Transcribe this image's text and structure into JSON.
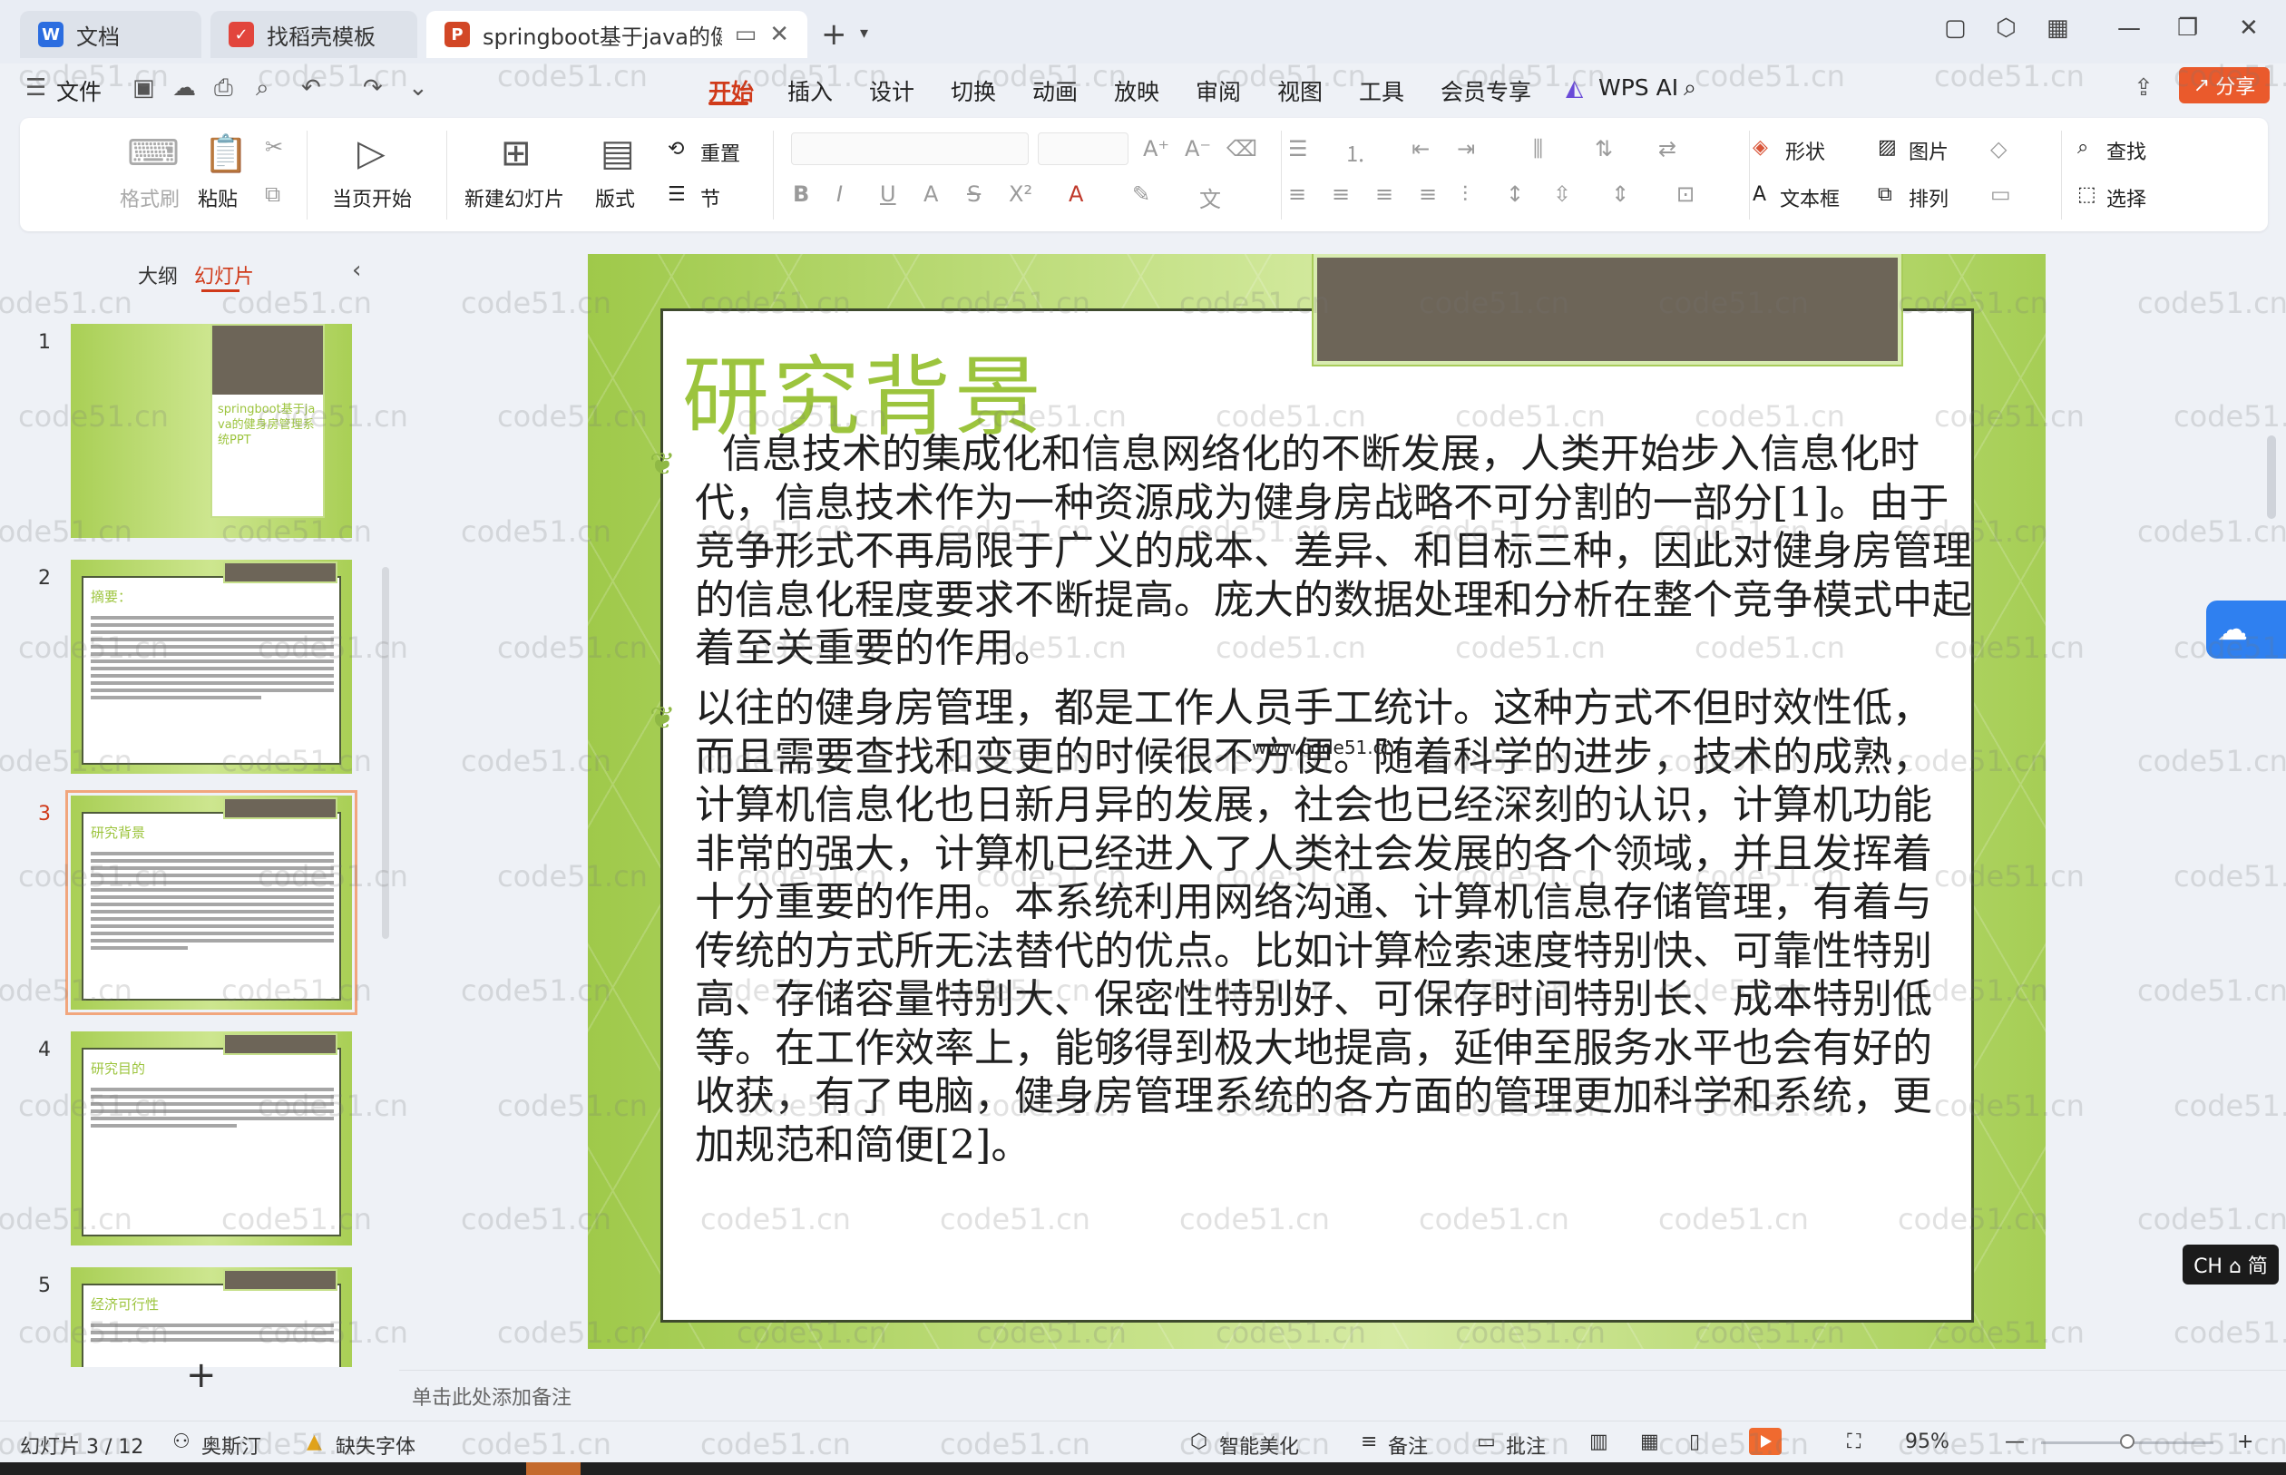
{
  "tabs": [
    {
      "label": "文档",
      "icon": "doc-icon",
      "color": "#2b6de0"
    },
    {
      "label": "找稻壳模板",
      "icon": "docer-icon",
      "color": "#e2453c"
    },
    {
      "label": "springboot基于java的健身房",
      "icon": "ppt-icon",
      "color": "#d24726"
    }
  ],
  "menu": {
    "file": "文件",
    "items": [
      "开始",
      "插入",
      "设计",
      "切换",
      "动画",
      "放映",
      "审阅",
      "视图",
      "工具",
      "会员专享"
    ],
    "active": "开始",
    "wps_ai": "WPS AI",
    "share": "分享"
  },
  "ribbon": {
    "format_painter": "格式刷",
    "paste": "粘贴",
    "play_from_current": "当页开始",
    "new_slide": "新建幻灯片",
    "layout": "版式",
    "reset": "重置",
    "section": "节",
    "shape": "形状",
    "picture": "图片",
    "find": "查找",
    "textbox": "文本框",
    "arrange": "排列",
    "select": "选择"
  },
  "left_panel": {
    "tab_outline": "大纲",
    "tab_slides": "幻灯片",
    "thumbnails": [
      {
        "num": "1",
        "title": "springboot基于java的健身房管理系统PPT"
      },
      {
        "num": "2",
        "title": "摘要："
      },
      {
        "num": "3",
        "title": "研究背景"
      },
      {
        "num": "4",
        "title": "研究目的"
      },
      {
        "num": "5",
        "title": "经济可行性"
      }
    ],
    "selected": 3
  },
  "slide": {
    "title": "研究背景",
    "paragraphs": [
      "信息技术的集成化和信息网络化的不断发展，人类开始步入信息化时代，信息技术作为一种资源成为健身房战略不可分割的一部分[1]。由于竞争形式不再局限于广义的成本、差异、和目标三种，因此对健身房管理的信息化程度要求不断提高。庞大的数据处理和分析在整个竞争模式中起着至关重要的作用。",
      "以往的健身房管理，都是工作人员手工统计。这种方式不但时效性低，而且需要查找和变更的时候很不方便。随着科学的进步，技术的成熟，计算机信息化也日新月异的发展，社会也已经深刻的认识，计算机功能非常的强大，计算机已经进入了人类社会发展的各个领域，并且发挥着十分重要的作用。本系统利用网络沟通、计算机信息存储管理，有着与传统的方式所无法替代的优点。比如计算检索速度特别快、可靠性特别高、存储容量特别大、保密性特别好、可保存时间特别长、成本特别低等。在工作效率上，能够得到极大地提高，延伸至服务水平也会有好的收获，有了电脑，健身房管理系统的各方面的管理更加科学和系统，更加规范和简便[2]。"
    ],
    "overlay_text": "www.code51.cn"
  },
  "notes_placeholder": "单击此处添加备注",
  "status": {
    "slide_counter": "幻灯片 3 / 12",
    "theme": "奥斯汀",
    "missing_font": "缺失字体",
    "beautify": "智能美化",
    "notes": "备注",
    "comments": "批注",
    "zoom": "95%"
  },
  "ime": "CH ⌂ 简",
  "watermark": "code51.cn",
  "colors": {
    "accent": "#d03a1a",
    "slide_green": "#9cc43d",
    "share": "#ea5a2c"
  }
}
